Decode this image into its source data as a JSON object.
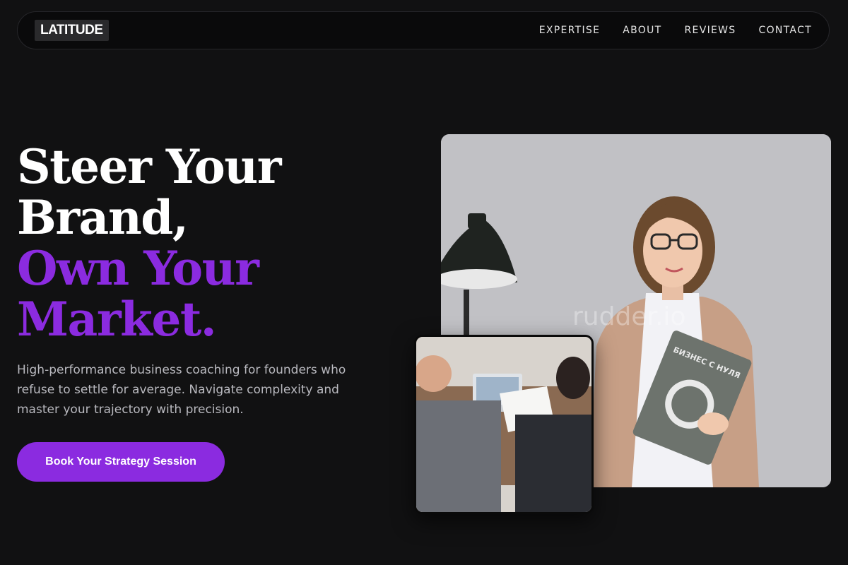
{
  "nav": {
    "logo": "LATITUDE",
    "links": [
      {
        "label": "EXPERTISE"
      },
      {
        "label": "ABOUT"
      },
      {
        "label": "REVIEWS"
      },
      {
        "label": "CONTACT"
      }
    ]
  },
  "hero": {
    "headline_white": [
      "Steer Your",
      "Brand,"
    ],
    "headline_accent": [
      "Own Your",
      "Market."
    ],
    "subtitle": "High-performance business coaching for founders who refuse to settle for average. Navigate complexity and master your trajectory with precision.",
    "cta_label": "Book Your Strategy Session"
  },
  "images": {
    "main_watermark": "rudder.io",
    "book_title": "БИЗНЕС С НУЛЯ"
  },
  "colors": {
    "background": "#111112",
    "accent": "#8b2be0",
    "text_primary": "#ffffff",
    "text_muted": "#b9b9bf"
  }
}
